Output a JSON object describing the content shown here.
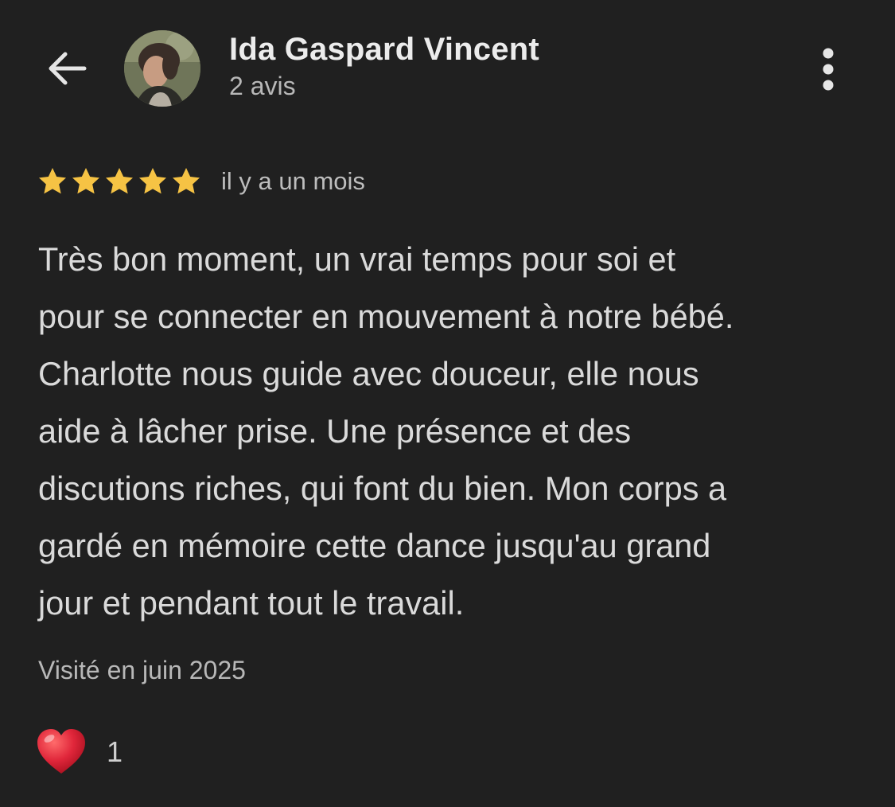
{
  "header": {
    "author_name": "Ida Gaspard Vincent",
    "author_subtitle": "2 avis",
    "back_icon": "arrow-left-icon",
    "more_icon": "more-vertical-icon"
  },
  "review": {
    "rating": 5,
    "max_rating": 5,
    "star_color": "#F6C344",
    "date": "il y a un mois",
    "text": "Très bon moment, un vrai temps pour soi et\npour se connecter en mouvement à notre bébé.\nCharlotte nous guide avec douceur, elle nous\naide à lâcher prise. Une présence et des\ndiscutions riches, qui font du bien. Mon corps a\ngardé en mémoire cette dance jusqu'au grand\njour et pendant tout le travail.",
    "visit_info": "Visité en juin 2025"
  },
  "reactions": {
    "icon": "heart-icon",
    "count": "1"
  },
  "colors": {
    "background": "#202020",
    "text_primary": "#ececec",
    "text_secondary": "#b8b8b8",
    "heart": "#E0263A"
  }
}
